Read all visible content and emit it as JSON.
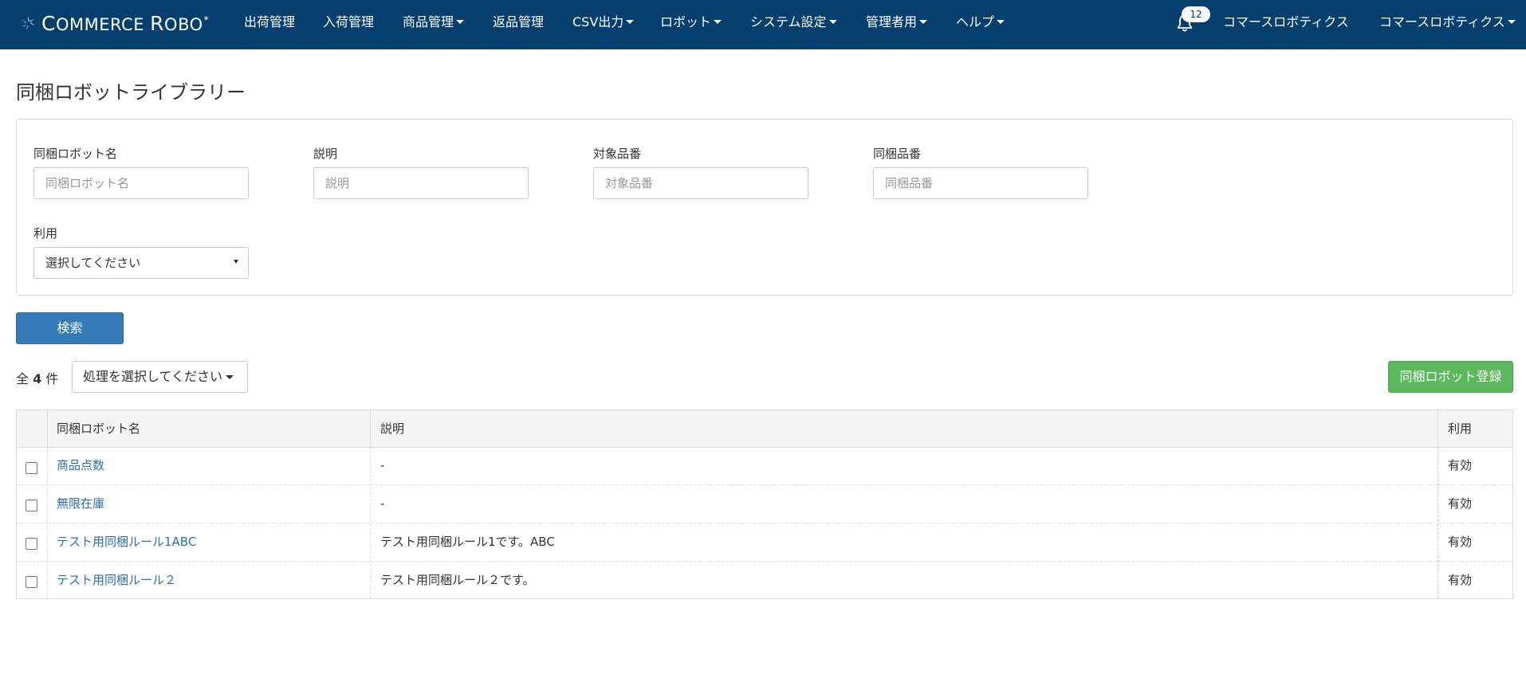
{
  "navbar": {
    "brand": {
      "c": "C",
      "ommerce": "OMMERCE",
      "r": "R",
      "obo": "OBO",
      "star": "*"
    },
    "menu": [
      {
        "label": "出荷管理",
        "dropdown": false
      },
      {
        "label": "入荷管理",
        "dropdown": false
      },
      {
        "label": "商品管理",
        "dropdown": true
      },
      {
        "label": "返品管理",
        "dropdown": false
      },
      {
        "label": "CSV出力",
        "dropdown": true
      },
      {
        "label": "ロボット",
        "dropdown": true
      },
      {
        "label": "システム設定",
        "dropdown": true
      },
      {
        "label": "管理者用",
        "dropdown": true
      },
      {
        "label": "ヘルプ",
        "dropdown": true
      }
    ],
    "notification_count": "12",
    "company": "コマースロボティクス",
    "user": "コマースロボティクス",
    "bg_color": "#053f6e"
  },
  "page": {
    "title": "同梱ロボットライブラリー"
  },
  "search": {
    "fields": [
      {
        "label": "同梱ロボット名",
        "placeholder": "同梱ロボット名",
        "value": ""
      },
      {
        "label": "説明",
        "placeholder": "説明",
        "value": ""
      },
      {
        "label": "対象品番",
        "placeholder": "対象品番",
        "value": ""
      },
      {
        "label": "同梱品番",
        "placeholder": "同梱品番",
        "value": ""
      }
    ],
    "usage": {
      "label": "利用",
      "selected": "選択してください"
    },
    "button": "検索",
    "button_color": "#337ab7"
  },
  "results": {
    "count_prefix": "全",
    "count": "4",
    "count_suffix": "件",
    "action_dropdown": "処理を選択してください",
    "register_button": "同梱ロボット登録",
    "register_color": "#5cb85c"
  },
  "table": {
    "headers": {
      "name": "同梱ロボット名",
      "description": "説明",
      "usage": "利用"
    },
    "rows": [
      {
        "name": "商品点数",
        "description": "-",
        "usage": "有効",
        "checked": false
      },
      {
        "name": "無限在庫",
        "description": "-",
        "usage": "有効",
        "checked": false
      },
      {
        "name": "テスト用同梱ルール1ABC",
        "description": "テスト用同梱ルール1です。ABC",
        "usage": "有効",
        "checked": false
      },
      {
        "name": "テスト用同梱ルール２",
        "description": "テスト用同梱ルール２です。",
        "usage": "有効",
        "checked": false
      }
    ],
    "link_color": "#2a6fb6"
  }
}
